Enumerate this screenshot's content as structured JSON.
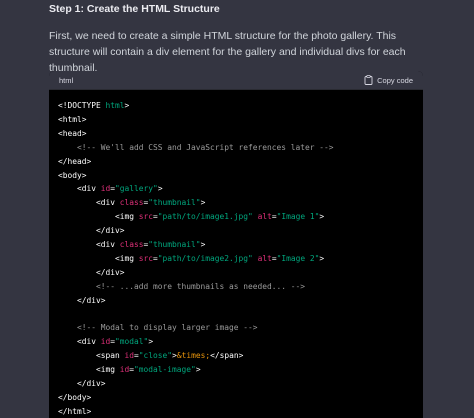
{
  "step": {
    "heading": "Step 1: Create the HTML Structure",
    "intro": "First, we need to create a simple HTML structure for the photo gallery. This structure will contain a div element for the gallery and individual divs for each thumbnail."
  },
  "code_block": {
    "language": "html",
    "copy_label": "Copy code",
    "copy_icon": "clipboard-icon",
    "lines": [
      [
        {
          "t": "tag",
          "v": "<!DOCTYPE "
        },
        {
          "t": "val",
          "v": "html"
        },
        {
          "t": "tag",
          "v": ">"
        }
      ],
      [
        {
          "t": "tag",
          "v": "<html>"
        }
      ],
      [
        {
          "t": "tag",
          "v": "<head>"
        }
      ],
      [
        {
          "t": "cmt",
          "v": "    <!-- We'll add CSS and JavaScript references later -->"
        }
      ],
      [
        {
          "t": "tag",
          "v": "</head>"
        }
      ],
      [
        {
          "t": "tag",
          "v": "<body>"
        }
      ],
      [
        {
          "t": "tag",
          "v": "    <div "
        },
        {
          "t": "attr",
          "v": "id"
        },
        {
          "t": "tag",
          "v": "="
        },
        {
          "t": "val",
          "v": "\"gallery\""
        },
        {
          "t": "tag",
          "v": ">"
        }
      ],
      [
        {
          "t": "tag",
          "v": "        <div "
        },
        {
          "t": "attr",
          "v": "class"
        },
        {
          "t": "tag",
          "v": "="
        },
        {
          "t": "val",
          "v": "\"thumbnail\""
        },
        {
          "t": "tag",
          "v": ">"
        }
      ],
      [
        {
          "t": "tag",
          "v": "            <img "
        },
        {
          "t": "attr",
          "v": "src"
        },
        {
          "t": "tag",
          "v": "="
        },
        {
          "t": "val",
          "v": "\"path/to/image1.jpg\""
        },
        {
          "t": "tag",
          "v": " "
        },
        {
          "t": "attr",
          "v": "alt"
        },
        {
          "t": "tag",
          "v": "="
        },
        {
          "t": "val",
          "v": "\"Image 1\""
        },
        {
          "t": "tag",
          "v": ">"
        }
      ],
      [
        {
          "t": "tag",
          "v": "        </div>"
        }
      ],
      [
        {
          "t": "tag",
          "v": "        <div "
        },
        {
          "t": "attr",
          "v": "class"
        },
        {
          "t": "tag",
          "v": "="
        },
        {
          "t": "val",
          "v": "\"thumbnail\""
        },
        {
          "t": "tag",
          "v": ">"
        }
      ],
      [
        {
          "t": "tag",
          "v": "            <img "
        },
        {
          "t": "attr",
          "v": "src"
        },
        {
          "t": "tag",
          "v": "="
        },
        {
          "t": "val",
          "v": "\"path/to/image2.jpg\""
        },
        {
          "t": "tag",
          "v": " "
        },
        {
          "t": "attr",
          "v": "alt"
        },
        {
          "t": "tag",
          "v": "="
        },
        {
          "t": "val",
          "v": "\"Image 2\""
        },
        {
          "t": "tag",
          "v": ">"
        }
      ],
      [
        {
          "t": "tag",
          "v": "        </div>"
        }
      ],
      [
        {
          "t": "cmt",
          "v": "        <!-- ...add more thumbnails as needed... -->"
        }
      ],
      [
        {
          "t": "tag",
          "v": "    </div>"
        }
      ],
      [
        {
          "t": "tag",
          "v": ""
        }
      ],
      [
        {
          "t": "cmt",
          "v": "    <!-- Modal to display larger image -->"
        }
      ],
      [
        {
          "t": "tag",
          "v": "    <div "
        },
        {
          "t": "attr",
          "v": "id"
        },
        {
          "t": "tag",
          "v": "="
        },
        {
          "t": "val",
          "v": "\"modal\""
        },
        {
          "t": "tag",
          "v": ">"
        }
      ],
      [
        {
          "t": "tag",
          "v": "        <span "
        },
        {
          "t": "attr",
          "v": "id"
        },
        {
          "t": "tag",
          "v": "="
        },
        {
          "t": "val",
          "v": "\"close\""
        },
        {
          "t": "tag",
          "v": ">"
        },
        {
          "t": "ent",
          "v": "&times;"
        },
        {
          "t": "tag",
          "v": "</span>"
        }
      ],
      [
        {
          "t": "tag",
          "v": "        <img "
        },
        {
          "t": "attr",
          "v": "id"
        },
        {
          "t": "tag",
          "v": "="
        },
        {
          "t": "val",
          "v": "\"modal-image\""
        },
        {
          "t": "tag",
          "v": ">"
        }
      ],
      [
        {
          "t": "tag",
          "v": "    </div>"
        }
      ],
      [
        {
          "t": "tag",
          "v": "</body>"
        }
      ],
      [
        {
          "t": "tag",
          "v": "</html>"
        }
      ]
    ]
  }
}
